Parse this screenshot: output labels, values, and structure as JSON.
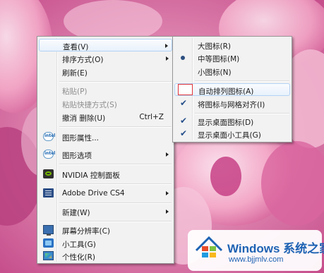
{
  "context_menu": {
    "items": [
      {
        "label": "查看(V)",
        "has_submenu": true,
        "highlighted": true
      },
      {
        "label": "排序方式(O)",
        "has_submenu": true
      },
      {
        "label": "刷新(E)"
      },
      {
        "label": "粘贴(P)",
        "disabled": true
      },
      {
        "label": "粘贴快捷方式(S)",
        "disabled": true
      },
      {
        "label": "撤消 删除(U)",
        "shortcut": "Ctrl+Z"
      },
      {
        "label": "图形属性...",
        "icon": "intel-icon"
      },
      {
        "label": "图形选项",
        "icon": "intel-icon",
        "has_submenu": true
      },
      {
        "label": "NVIDIA 控制面板",
        "icon": "nvidia-icon"
      },
      {
        "label": "Adobe Drive CS4",
        "icon": "adobe-drive-icon",
        "has_submenu": true
      },
      {
        "label": "新建(W)",
        "has_submenu": true
      },
      {
        "label": "屏幕分辨率(C)",
        "icon": "monitor-icon"
      },
      {
        "label": "小工具(G)",
        "icon": "gadget-icon"
      },
      {
        "label": "个性化(R)",
        "icon": "personalize-icon"
      }
    ]
  },
  "view_submenu": {
    "items": [
      {
        "label": "大图标(R)"
      },
      {
        "label": "中等图标(M)",
        "selected": true
      },
      {
        "label": "小图标(N)"
      },
      {
        "label": "自动排列图标(A)",
        "checked": false,
        "highlighted": true
      },
      {
        "label": "将图标与网格对齐(I)",
        "checked": true
      },
      {
        "label": "显示桌面图标(D)",
        "checked": true
      },
      {
        "label": "显示桌面小工具(G)",
        "checked": true
      }
    ]
  },
  "watermark": {
    "title": "Windows 系统之家",
    "url": "www.bjjmlv.com"
  },
  "colors": {
    "menu_bg": "#f2f2f2",
    "highlight_border": "#b4d3f5",
    "annotation_red": "#e0353b",
    "watermark_blue": "#1d62b3"
  }
}
